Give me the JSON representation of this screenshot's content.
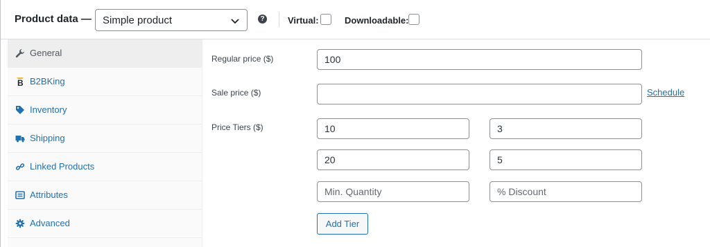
{
  "header": {
    "title": "Product data —",
    "product_type": "Simple product",
    "help_glyph": "?",
    "virtual_label": "Virtual:",
    "virtual_checked": false,
    "downloadable_label": "Downloadable:",
    "downloadable_checked": false
  },
  "sidebar": {
    "items": [
      {
        "label": "General",
        "icon": "wrench-icon",
        "active": true
      },
      {
        "label": "B2BKing",
        "icon": "b2bking-logo-icon",
        "active": false
      },
      {
        "label": "Inventory",
        "icon": "tag-icon",
        "active": false
      },
      {
        "label": "Shipping",
        "icon": "truck-icon",
        "active": false
      },
      {
        "label": "Linked Products",
        "icon": "link-icon",
        "active": false
      },
      {
        "label": "Attributes",
        "icon": "list-icon",
        "active": false
      },
      {
        "label": "Advanced",
        "icon": "gear-icon",
        "active": false
      }
    ]
  },
  "main": {
    "regular_price_label": "Regular price ($)",
    "regular_price_value": "100",
    "sale_price_label": "Sale price ($)",
    "sale_price_value": "",
    "schedule_link": "Schedule",
    "price_tiers_label": "Price Tiers ($)",
    "tiers": [
      {
        "quantity": "10",
        "discount": "3"
      },
      {
        "quantity": "20",
        "discount": "5"
      }
    ],
    "new_tier_quantity_placeholder": "Min. Quantity",
    "new_tier_discount_placeholder": "% Discount",
    "add_tier_label": "Add Tier"
  },
  "colors": {
    "link": "#2271b1",
    "active_tab_bg": "#eeeeee",
    "sidebar_bg": "#fafafa"
  }
}
